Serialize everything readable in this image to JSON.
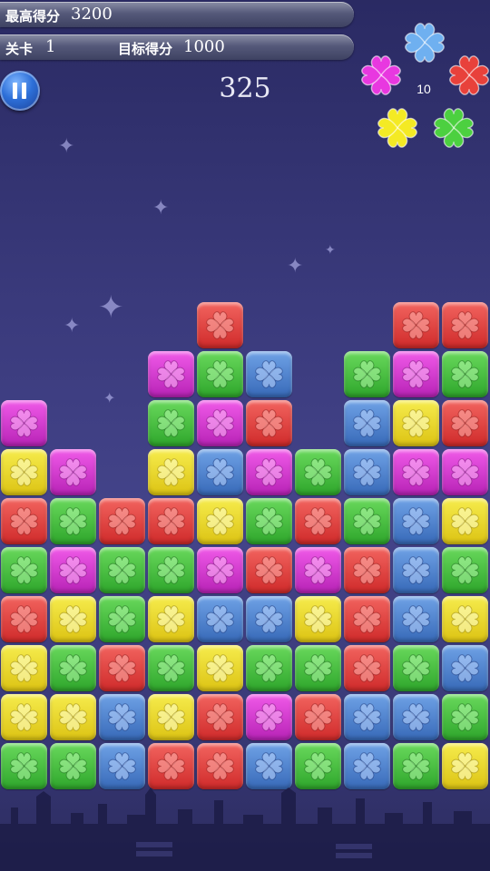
{
  "hud": {
    "best_label": "最高得分",
    "best_value": "3200",
    "level_label": "关卡",
    "level_value": "1",
    "target_label": "目标得分",
    "target_value": "1000"
  },
  "score": "325",
  "clover_bonus": {
    "count": "10",
    "colors": [
      "blue",
      "red",
      "green",
      "yellow",
      "purple"
    ]
  },
  "palette": {
    "red": "#d93a36",
    "green": "#3cb638",
    "blue": "#4a7ccb",
    "yellow": "#e8d520",
    "purple": "#cc32c8"
  },
  "board": {
    "columns": 10,
    "rows": 10,
    "cells": [
      [
        null,
        null,
        null,
        null,
        "red",
        null,
        null,
        null,
        "red",
        "red"
      ],
      [
        null,
        null,
        null,
        "purple",
        "green",
        "blue",
        null,
        "green",
        "purple",
        "green"
      ],
      [
        "purple",
        null,
        null,
        "green",
        "purple",
        "red",
        null,
        "blue",
        "yellow",
        "red"
      ],
      [
        "yellow",
        "purple",
        null,
        "yellow",
        "blue",
        "purple",
        "green",
        "blue",
        "purple",
        "purple"
      ],
      [
        "red",
        "green",
        "red",
        "red",
        "yellow",
        "green",
        "red",
        "green",
        "blue",
        "yellow"
      ],
      [
        "green",
        "purple",
        "green",
        "green",
        "purple",
        "red",
        "purple",
        "red",
        "blue",
        "green"
      ],
      [
        "red",
        "yellow",
        "green",
        "yellow",
        "blue",
        "blue",
        "yellow",
        "red",
        "blue",
        "yellow"
      ],
      [
        "yellow",
        "green",
        "red",
        "green",
        "yellow",
        "green",
        "green",
        "red",
        "green",
        "blue"
      ],
      [
        "yellow",
        "yellow",
        "blue",
        "yellow",
        "red",
        "purple",
        "red",
        "blue",
        "blue",
        "green"
      ],
      [
        "green",
        "green",
        "blue",
        "red",
        "red",
        "blue",
        "green",
        "blue",
        "green",
        "yellow"
      ]
    ]
  }
}
